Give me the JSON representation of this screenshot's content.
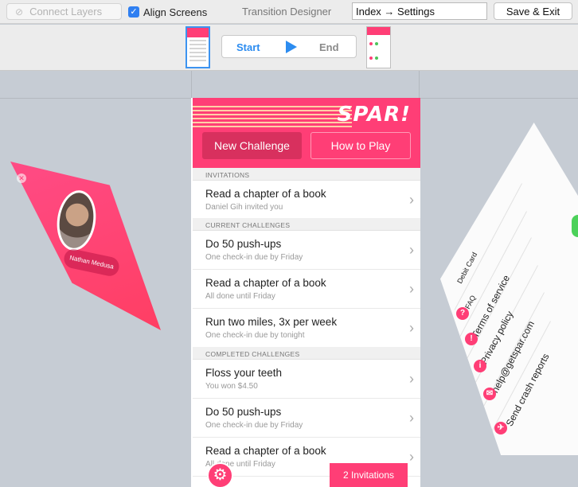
{
  "toolbar": {
    "connect_label": "Connect Layers",
    "align_label": "Align Screens",
    "align_checked": true,
    "title": "Transition Designer",
    "index_value": "Index → Settings",
    "save_label": "Save & Exit"
  },
  "transport": {
    "start_label": "Start",
    "end_label": "End",
    "play_icon": "play-icon"
  },
  "left_screen": {
    "name": "Nathan Medusa"
  },
  "phone": {
    "logo": "SPAR!",
    "new_challenge": "New Challenge",
    "how_to_play": "How to Play",
    "sections": {
      "invitations": "INVITATIONS",
      "current": "CURRENT CHALLENGES",
      "completed": "COMPLETED CHALLENGES"
    },
    "invitations": [
      {
        "title": "Read a chapter of a book",
        "sub": "Daniel Gih invited you"
      }
    ],
    "current": [
      {
        "title": "Do 50 push-ups",
        "sub": "One check-in due by Friday"
      },
      {
        "title": "Read a chapter of a book",
        "sub": "All done until Friday"
      },
      {
        "title": "Run two miles, 3x per week",
        "sub": "One check-in due by tonight"
      }
    ],
    "completed": [
      {
        "title": "Floss your teeth",
        "sub": "You won $4.50"
      },
      {
        "title": "Do 50 push-ups",
        "sub": "One check-in due by Friday"
      },
      {
        "title": "Read a chapter of a book",
        "sub": "All done until Friday"
      }
    ],
    "invitations_button": "2 Invitations",
    "accent": "#ff3e76"
  },
  "right_screen": {
    "items": [
      "Debit Card",
      "FAQ",
      "Terms of service",
      "Privacy policy",
      "help@getspar.com",
      "Send crash reports"
    ]
  }
}
